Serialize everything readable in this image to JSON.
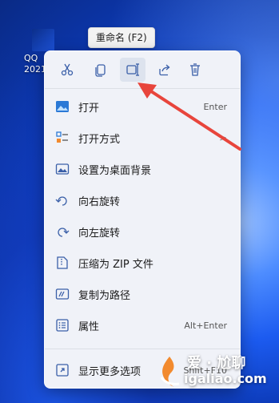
{
  "desktop": {
    "icon_label": "QQ\n2021"
  },
  "tooltip": {
    "text": "重命名 (F2)"
  },
  "toolbar": {
    "buttons": [
      {
        "name": "cut",
        "icon": "scissors-icon"
      },
      {
        "name": "copy",
        "icon": "copy-icon"
      },
      {
        "name": "rename",
        "icon": "rename-icon"
      },
      {
        "name": "share",
        "icon": "share-icon"
      },
      {
        "name": "delete",
        "icon": "trash-icon"
      }
    ]
  },
  "menu": {
    "items": [
      {
        "label": "打开",
        "shortcut": "Enter",
        "icon": "image-icon"
      },
      {
        "label": "打开方式",
        "submenu": ">",
        "icon": "open-with-icon"
      },
      {
        "label": "设置为桌面背景",
        "icon": "wallpaper-icon"
      },
      {
        "label": "向右旋转",
        "icon": "rotate-right-icon"
      },
      {
        "label": "向左旋转",
        "icon": "rotate-left-icon"
      },
      {
        "label": "压缩为 ZIP 文件",
        "icon": "zip-icon"
      },
      {
        "label": "复制为路径",
        "icon": "copy-path-icon"
      },
      {
        "label": "属性",
        "shortcut": "Alt+Enter",
        "icon": "properties-icon"
      },
      {
        "label": "显示更多选项",
        "shortcut": "Shift+F10",
        "icon": "more-options-icon"
      }
    ]
  },
  "watermark": {
    "line1": "爱 · 尬聊",
    "line2": "igaliao.com"
  },
  "colors": {
    "accent": "#1a73e8",
    "arrow": "#e8453c"
  }
}
